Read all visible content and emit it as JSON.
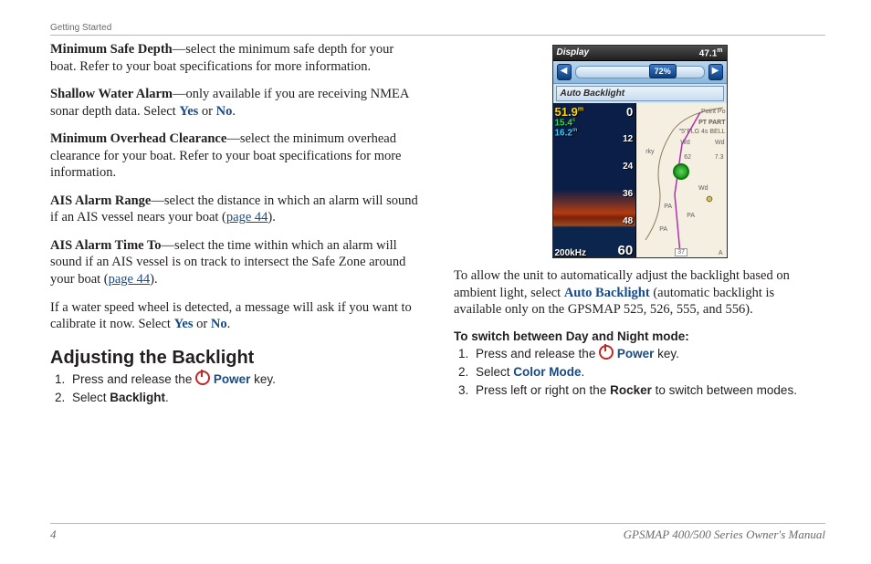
{
  "header": {
    "section": "Getting Started"
  },
  "left": {
    "msd": {
      "term": "Minimum Safe Depth",
      "text": "—select the minimum safe depth for your boat. Refer to your boat specifications for more information."
    },
    "swa": {
      "term": "Shallow Water Alarm",
      "text1": "—only available if you are receiving NMEA sonar depth data. Select ",
      "yes": "Yes",
      "or": " or ",
      "no": "No",
      "dot": "."
    },
    "moc": {
      "term": "Minimum Overhead Clearance",
      "text": "—select the minimum overhead clearance for your boat. Refer to your boat specifications for more information."
    },
    "aar": {
      "term": "AIS Alarm Range",
      "text1": "—select the distance in which an alarm will sound if an AIS vessel nears your boat (",
      "link": "page 44",
      "text2": ")."
    },
    "aat": {
      "term": "AIS Alarm Time To",
      "text1": "—select the time within which an alarm will sound if an AIS vessel is on track to intersect the Safe Zone around your boat (",
      "link": "page 44",
      "text2": ")."
    },
    "wsw": {
      "text1": "If a water speed wheel is detected, a message will ask if you want to calibrate it now. Select ",
      "yes": "Yes",
      "or": " or ",
      "no": "No",
      "dot": "."
    },
    "heading": "Adjusting the Backlight",
    "steps": {
      "s1a": "Press and release the ",
      "power": "Power",
      "s1b": " key.",
      "s2a": "Select ",
      "backlight": "Backlight",
      "s2b": "."
    }
  },
  "device": {
    "title": "Display",
    "reading": "47.1",
    "unit": "m",
    "left_arrow": "◀",
    "right_arrow": "▶",
    "percent": "72%",
    "auto": "Auto Backlight",
    "sonar": {
      "depth": "51.9",
      "depth_unit": "m",
      "temp": "15.4",
      "temp_unit": "c",
      "v3": "16.2",
      "v3_unit": "m",
      "r0": "0",
      "r12": "12",
      "r24": "24",
      "r36": "36",
      "r48": "48",
      "r60": "60",
      "freq": "200kHz"
    },
    "chart": {
      "lbl_pointpo": "Point Po",
      "lbl_ptpart": "PT PART",
      "lbl_flg": "\"5\"FLG 4s BELL",
      "lbl_wd1": "Wd",
      "lbl_wd2": "Wd",
      "lbl_wd3": "Wd",
      "lbl_rky": "rky",
      "lbl_62": "62",
      "lbl_73": "7.3",
      "lbl_pa1": "PA",
      "lbl_pa2": "PA",
      "lbl_pa3": "PA",
      "lbl_37": "37",
      "lbl_a": "A"
    }
  },
  "right": {
    "para": {
      "t1": "To allow the unit to automatically adjust the backlight based on ambient light, select ",
      "auto": "Auto Backlight",
      "t2": " (automatic backlight is available only on the GPSMAP 525, 526, 555, and 556)."
    },
    "steps_title": "To switch between Day and Night mode:",
    "steps": {
      "s1a": "Press and release the ",
      "power": "Power",
      "s1b": " key.",
      "s2a": "Select ",
      "color": "Color Mode",
      "s2b": ".",
      "s3a": "Press left or right on the ",
      "rocker": "Rocker",
      "s3b": " to switch between modes."
    }
  },
  "footer": {
    "page": "4",
    "manual": "GPSMAP 400/500 Series Owner's Manual"
  }
}
